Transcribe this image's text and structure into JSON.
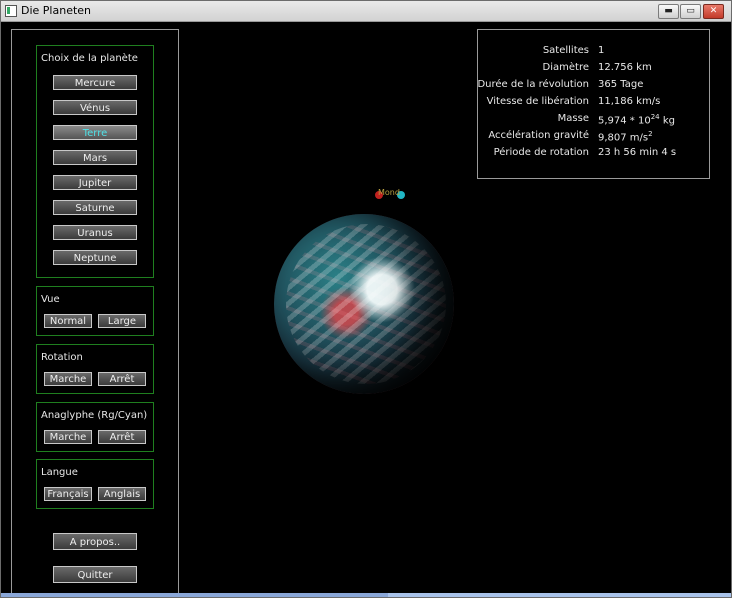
{
  "window": {
    "title": "Die Planeten",
    "controls": {
      "minimize": "▬",
      "maximize": "▭",
      "close": "✕"
    }
  },
  "left_panel": {
    "planet_group": {
      "label": "Choix de la planète",
      "planets": [
        "Mercure",
        "Vénus",
        "Terre",
        "Mars",
        "Jupiter",
        "Saturne",
        "Uranus",
        "Neptune"
      ],
      "selected": "Terre"
    },
    "vue": {
      "label": "Vue",
      "buttons": [
        "Normal",
        "Large"
      ]
    },
    "rotation": {
      "label": "Rotation",
      "buttons": [
        "Marche",
        "Arrêt"
      ]
    },
    "anaglyph": {
      "label": "Anaglyphe (Rg/Cyan)",
      "buttons": [
        "Marche",
        "Arrêt"
      ]
    },
    "langue": {
      "label": "Langue",
      "buttons": [
        "Français",
        "Anglais"
      ]
    },
    "apropos": "A propos..",
    "quitter": "Quitter"
  },
  "info_panel": {
    "rows": [
      {
        "label": "Satellites",
        "value": "1"
      },
      {
        "label": "Diamètre",
        "value": "12.756 km"
      },
      {
        "label": "Durée de la révolution",
        "value": "365 Tage"
      },
      {
        "label": "Vitesse de libération",
        "value": "11,186 km/s"
      },
      {
        "label": "Masse",
        "value_main": "5,974 * 10",
        "value_sup": "24",
        "value_unit": "kg"
      },
      {
        "label": "Accélération gravité",
        "value_main": "9,807 m/s",
        "value_sup": "2",
        "value_unit": ""
      },
      {
        "label": "Période de rotation",
        "value": "23 h 56 min 4 s"
      }
    ]
  },
  "viewport": {
    "moon_label": "Mond",
    "colors": {
      "anaglyph_red": "#c0211f",
      "anaglyph_cyan": "#20b6c4",
      "accent_active": "#4fe3e9",
      "group_border": "#1f7f1f"
    }
  }
}
